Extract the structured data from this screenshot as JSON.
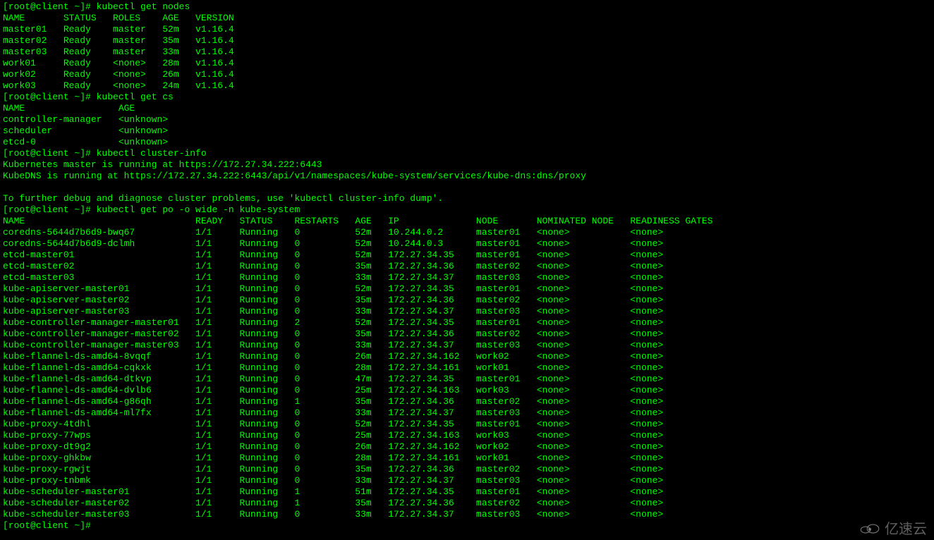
{
  "prompt_prefix": "[root@client ~]# ",
  "commands": {
    "cmd1": "kubectl get nodes",
    "cmd2": "kubectl get cs",
    "cmd3": "kubectl cluster-info",
    "cmd4": "kubectl get po -o wide -n kube-system"
  },
  "nodes_header": "NAME       STATUS   ROLES    AGE   VERSION",
  "nodes": [
    "master01   Ready    master   52m   v1.16.4",
    "master02   Ready    master   35m   v1.16.4",
    "master03   Ready    master   33m   v1.16.4",
    "work01     Ready    <none>   28m   v1.16.4",
    "work02     Ready    <none>   26m   v1.16.4",
    "work03     Ready    <none>   24m   v1.16.4"
  ],
  "cs_header": "NAME                 AGE",
  "cs": [
    "controller-manager   <unknown>",
    "scheduler            <unknown>",
    "etcd-0               <unknown>"
  ],
  "cluster_info": {
    "line1": "Kubernetes master is running at https://172.27.34.222:6443",
    "line2": "KubeDNS is running at https://172.27.34.222:6443/api/v1/namespaces/kube-system/services/kube-dns:dns/proxy",
    "blank": "",
    "line3": "To further debug and diagnose cluster problems, use 'kubectl cluster-info dump'."
  },
  "pods_header": "NAME                               READY   STATUS    RESTARTS   AGE   IP              NODE       NOMINATED NODE   READINESS GATES",
  "pods": [
    "coredns-5644d7b6d9-bwq67           1/1     Running   0          52m   10.244.0.2      master01   <none>           <none>",
    "coredns-5644d7b6d9-dclmh           1/1     Running   0          52m   10.244.0.3      master01   <none>           <none>",
    "etcd-master01                      1/1     Running   0          52m   172.27.34.35    master01   <none>           <none>",
    "etcd-master02                      1/1     Running   0          35m   172.27.34.36    master02   <none>           <none>",
    "etcd-master03                      1/1     Running   0          33m   172.27.34.37    master03   <none>           <none>",
    "kube-apiserver-master01            1/1     Running   0          52m   172.27.34.35    master01   <none>           <none>",
    "kube-apiserver-master02            1/1     Running   0          35m   172.27.34.36    master02   <none>           <none>",
    "kube-apiserver-master03            1/1     Running   0          33m   172.27.34.37    master03   <none>           <none>",
    "kube-controller-manager-master01   1/1     Running   2          52m   172.27.34.35    master01   <none>           <none>",
    "kube-controller-manager-master02   1/1     Running   0          35m   172.27.34.36    master02   <none>           <none>",
    "kube-controller-manager-master03   1/1     Running   0          33m   172.27.34.37    master03   <none>           <none>",
    "kube-flannel-ds-amd64-8vqqf        1/1     Running   0          26m   172.27.34.162   work02     <none>           <none>",
    "kube-flannel-ds-amd64-cqkxk        1/1     Running   0          28m   172.27.34.161   work01     <none>           <none>",
    "kube-flannel-ds-amd64-dtkvp        1/1     Running   0          47m   172.27.34.35    master01   <none>           <none>",
    "kube-flannel-ds-amd64-dvlb6        1/1     Running   0          25m   172.27.34.163   work03     <none>           <none>",
    "kube-flannel-ds-amd64-g86qh        1/1     Running   1          35m   172.27.34.36    master02   <none>           <none>",
    "kube-flannel-ds-amd64-ml7fx        1/1     Running   0          33m   172.27.34.37    master03   <none>           <none>",
    "kube-proxy-4tdhl                   1/1     Running   0          52m   172.27.34.35    master01   <none>           <none>",
    "kube-proxy-77wps                   1/1     Running   0          25m   172.27.34.163   work03     <none>           <none>",
    "kube-proxy-dt9g2                   1/1     Running   0          26m   172.27.34.162   work02     <none>           <none>",
    "kube-proxy-ghkbw                   1/1     Running   0          28m   172.27.34.161   work01     <none>           <none>",
    "kube-proxy-rgwjt                   1/1     Running   0          35m   172.27.34.36    master02   <none>           <none>",
    "kube-proxy-tnbmk                   1/1     Running   0          33m   172.27.34.37    master03   <none>           <none>",
    "kube-scheduler-master01            1/1     Running   1          51m   172.27.34.35    master01   <none>           <none>",
    "kube-scheduler-master02            1/1     Running   1          35m   172.27.34.36    master02   <none>           <none>",
    "kube-scheduler-master03            1/1     Running   0          33m   172.27.34.37    master03   <none>           <none>"
  ],
  "final_prompt": "[root@client ~]# ",
  "watermark_text": "亿速云"
}
